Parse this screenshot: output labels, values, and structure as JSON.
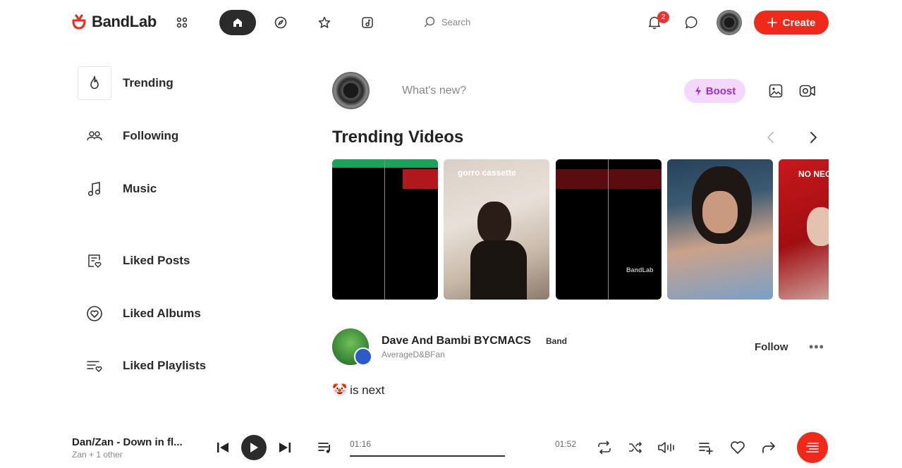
{
  "header": {
    "logo_text": "BandLab",
    "search_placeholder": "Search",
    "notification_count": "2",
    "create_label": "Create"
  },
  "sidebar": {
    "items": [
      {
        "label": "Trending",
        "icon": "flame-icon"
      },
      {
        "label": "Following",
        "icon": "users-icon"
      },
      {
        "label": "Music",
        "icon": "music-note-icon"
      },
      {
        "label": "Liked Posts",
        "icon": "liked-posts-icon"
      },
      {
        "label": "Liked Albums",
        "icon": "heart-circle-icon"
      },
      {
        "label": "Liked Playlists",
        "icon": "liked-playlist-icon"
      }
    ]
  },
  "composer": {
    "placeholder": "What's new?",
    "boost_label": "Boost"
  },
  "trending": {
    "title": "Trending Videos",
    "thumbnails": [
      {
        "caption": ""
      },
      {
        "caption": "gorro cassette"
      },
      {
        "caption": "BandLab"
      },
      {
        "caption": ""
      },
      {
        "caption": "NO NEO"
      }
    ]
  },
  "post": {
    "author": "Dave And Bambi BYCMACS",
    "tag": "Band",
    "handle": "AverageD&BFan",
    "follow_label": "Follow",
    "more": "•••",
    "emoji": "🤡",
    "text": "is next"
  },
  "player": {
    "track_title": "Dan/Zan - Down in fl...",
    "track_artist": "Zan + 1 other",
    "elapsed": "01:16",
    "duration": "01:52"
  },
  "colors": {
    "brand_red": "#f0291a",
    "boost_bg": "#f3d8fb",
    "boost_text": "#9b2fd0",
    "dark": "#2b2b2b"
  }
}
